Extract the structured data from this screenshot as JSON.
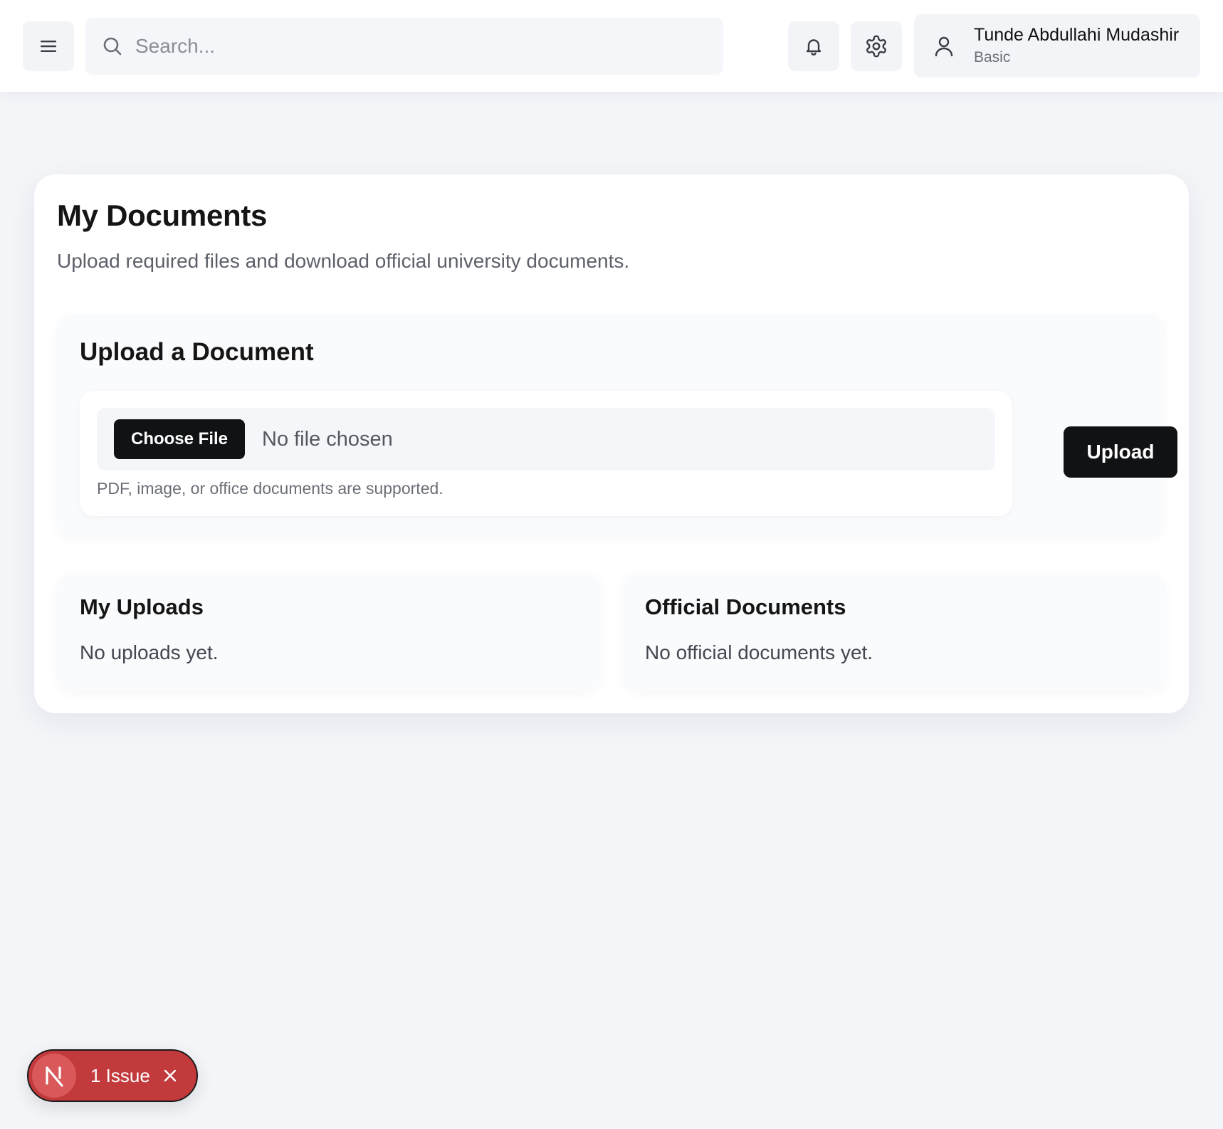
{
  "header": {
    "search": {
      "placeholder": "Search..."
    },
    "user": {
      "name": "Tunde Abdullahi Mudashir",
      "plan": "Basic"
    }
  },
  "page": {
    "title": "My Documents",
    "subtitle": "Upload required files and download official university documents."
  },
  "upload_section": {
    "title": "Upload a Document",
    "choose_file_label": "Choose File",
    "file_status": "No file chosen",
    "hint": "PDF, image, or office documents are supported.",
    "upload_label": "Upload"
  },
  "my_uploads": {
    "title": "My Uploads",
    "empty_text": "No uploads yet."
  },
  "official_documents": {
    "title": "Official Documents",
    "empty_text": "No official documents yet."
  },
  "issue_badge": {
    "logo_letter": "N",
    "text": "1 Issue"
  },
  "icons": {
    "menu": "menu-icon",
    "search": "search-icon",
    "bell": "bell-icon",
    "gear": "gear-icon",
    "user": "user-icon",
    "close": "close-icon"
  },
  "colors": {
    "background": "#f4f5f9",
    "primary_button": "#111214",
    "issue_badge": "#c33a3c"
  }
}
